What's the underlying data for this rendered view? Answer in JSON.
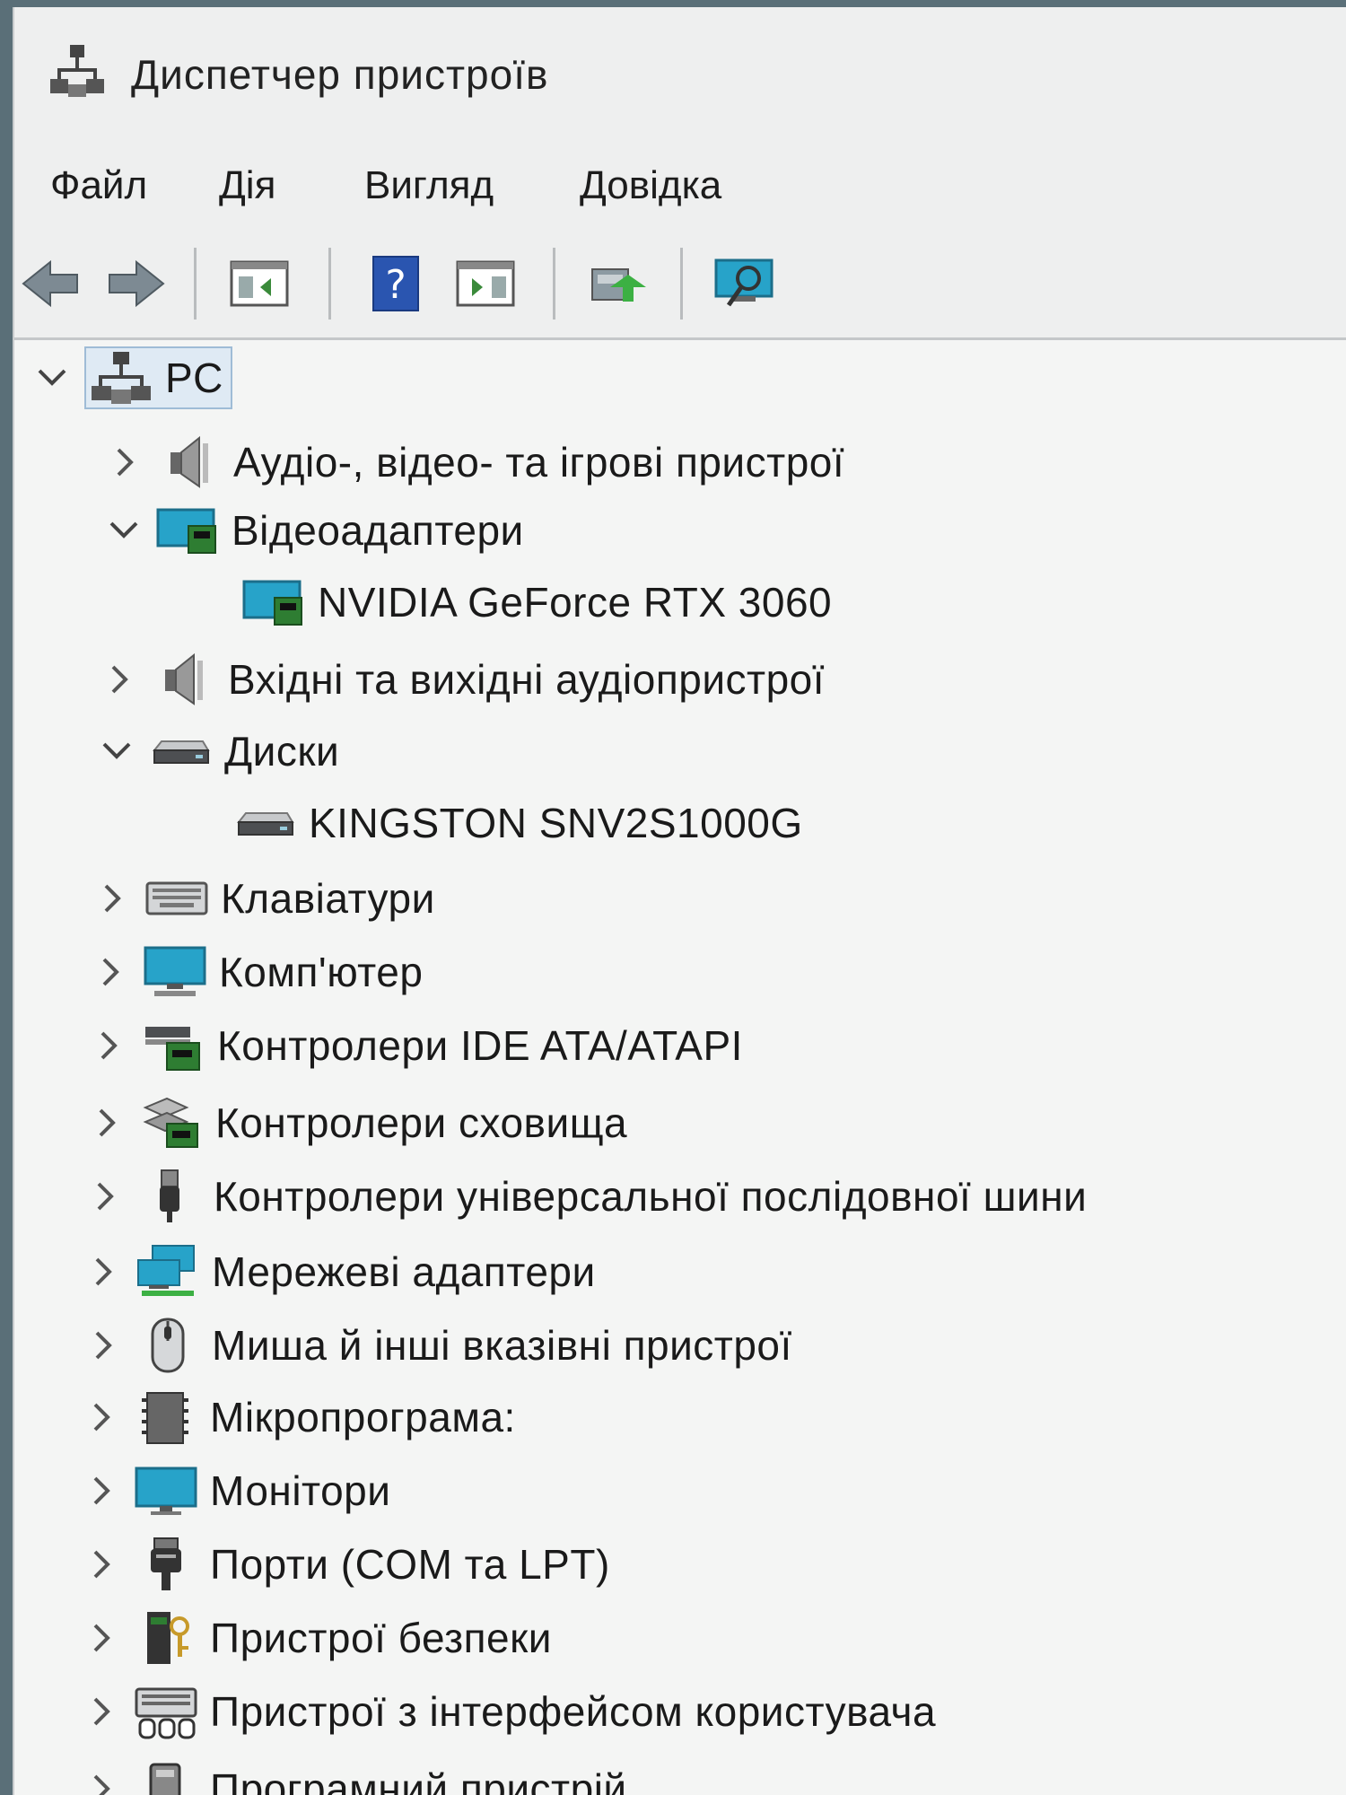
{
  "window": {
    "title": "Диспетчер пристроїв",
    "icon": "device-manager-icon"
  },
  "menu": {
    "file": "Файл",
    "action": "Дія",
    "view": "Вигляд",
    "help": "Довідка"
  },
  "toolbar": {
    "buttons": [
      "back-arrow-icon",
      "forward-arrow-icon",
      "show-hide-console-tree-icon",
      "help-icon",
      "properties-icon",
      "update-driver-icon",
      "scan-hardware-icon"
    ]
  },
  "tree": {
    "root": "PC",
    "items": [
      {
        "label": "Аудіо-, відео- та ігрові пристрої",
        "icon": "speaker-icon",
        "expanded": false
      },
      {
        "label": "Відеоадаптери",
        "icon": "display-adapter-icon",
        "expanded": true
      },
      {
        "label": "NVIDIA GeForce RTX 3060",
        "icon": "display-adapter-icon"
      },
      {
        "label": "Вхідні та вихідні аудіопристрої",
        "icon": "speaker-icon",
        "expanded": false
      },
      {
        "label": "Диски",
        "icon": "disk-drive-icon",
        "expanded": true
      },
      {
        "label": "KINGSTON SNV2S1000G",
        "icon": "disk-drive-icon"
      },
      {
        "label": "Клавіатури",
        "icon": "keyboard-icon",
        "expanded": false
      },
      {
        "label": "Комп'ютер",
        "icon": "computer-icon",
        "expanded": false
      },
      {
        "label": "Контролери IDE ATA/ATAPI",
        "icon": "ide-controller-icon",
        "expanded": false
      },
      {
        "label": "Контролери сховища",
        "icon": "storage-controller-icon",
        "expanded": false
      },
      {
        "label": "Контролери універсальної послідовної шини",
        "icon": "usb-icon",
        "expanded": false
      },
      {
        "label": "Мережеві адаптери",
        "icon": "network-adapter-icon",
        "expanded": false
      },
      {
        "label": "Миша й інші вказівні пристрої",
        "icon": "mouse-icon",
        "expanded": false
      },
      {
        "label": "Мікропрограма:",
        "icon": "firmware-icon",
        "expanded": false
      },
      {
        "label": "Монітори",
        "icon": "monitor-icon",
        "expanded": false
      },
      {
        "label": "Порти (COM та LPT)",
        "icon": "port-icon",
        "expanded": false
      },
      {
        "label": "Пристрої безпеки",
        "icon": "security-device-icon",
        "expanded": false
      },
      {
        "label": "Пристрої з інтерфейсом користувача",
        "icon": "hid-icon",
        "expanded": false
      },
      {
        "label": "Програмний пристрій",
        "icon": "software-device-icon",
        "expanded": false
      }
    ]
  }
}
